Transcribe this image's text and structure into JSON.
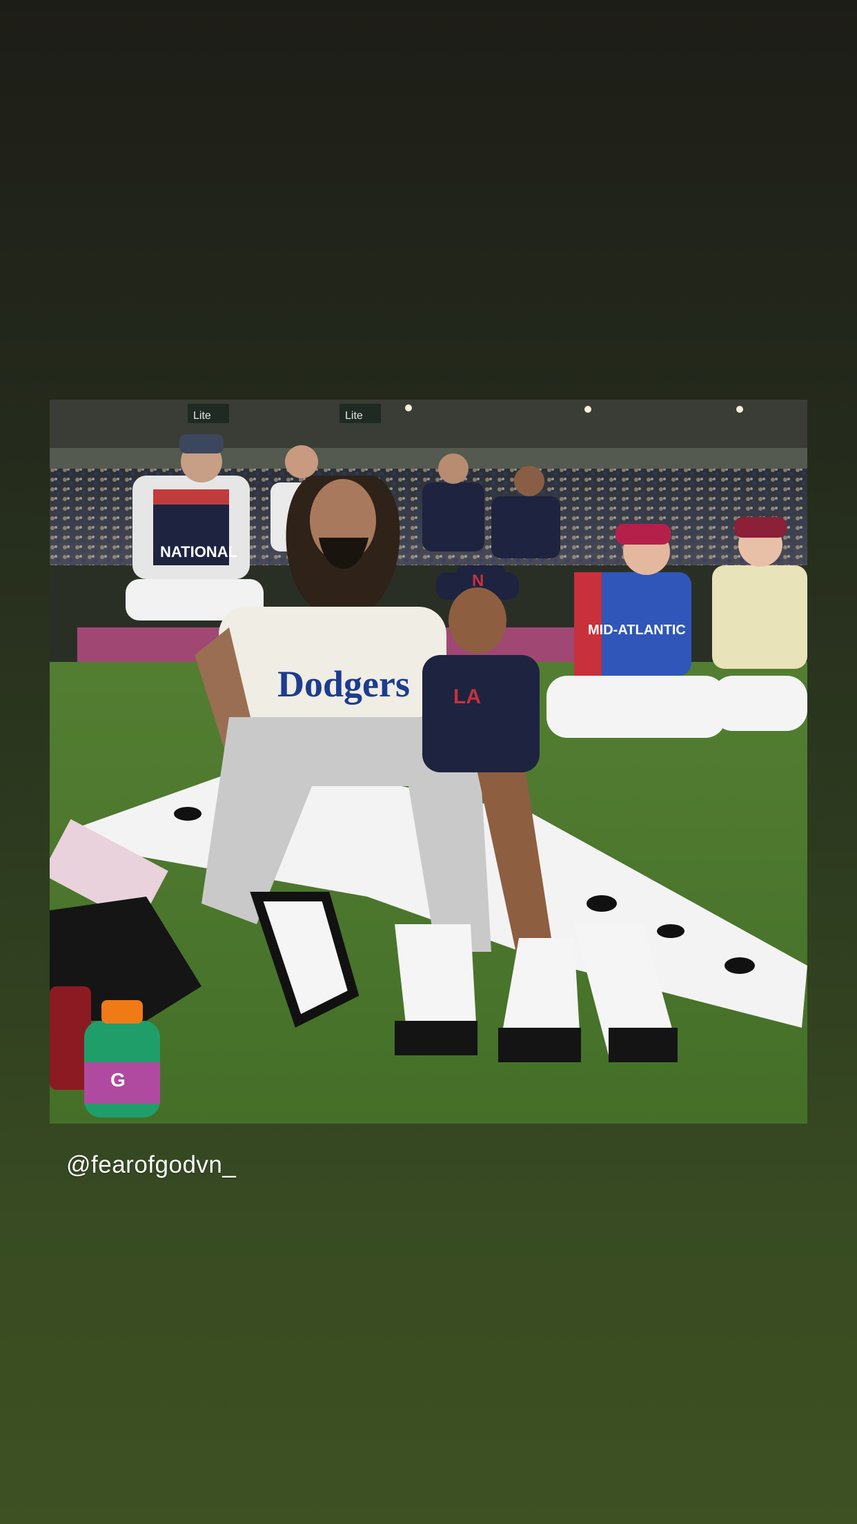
{
  "story": {
    "mention_text": "@fearofgodvn_",
    "background_top_color": "#1d1d17",
    "background_bottom_color": "#3d5123"
  },
  "photo": {
    "subject": "baseball-field-photo",
    "visible_print": {
      "stadium_sign_left": "Lite",
      "stadium_sign_mid": "Lite",
      "jersey_left": "NATIONAL",
      "jersey_main": "Dodgers",
      "jersey_kid_cap": "LA",
      "jersey_right": "MID-ATLANTIC",
      "bottle_brand": "G"
    }
  }
}
